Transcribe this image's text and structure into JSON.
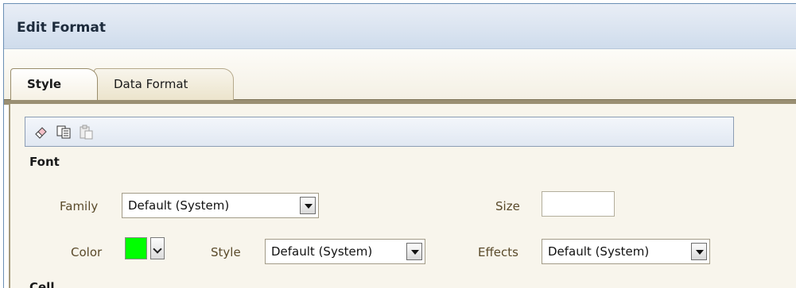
{
  "dialog": {
    "title": "Edit Format"
  },
  "tabs": [
    {
      "label": "Style",
      "active": true
    },
    {
      "label": "Data Format",
      "active": false
    }
  ],
  "toolbar": {
    "icons": [
      "eraser-icon",
      "copy-icon",
      "paste-icon"
    ]
  },
  "font_section": {
    "heading": "Font",
    "family_label": "Family",
    "family_value": "Default (System)",
    "size_label": "Size",
    "size_value": "",
    "color_label": "Color",
    "color_value": "#00ff00",
    "style_label": "Style",
    "style_value": "Default (System)",
    "effects_label": "Effects",
    "effects_value": "Default (System)"
  },
  "next_section": {
    "heading": "Cell"
  },
  "colors": {
    "title_bar": "#cfdcec",
    "panel_bg": "#f8f5ec",
    "tab_border": "#9a8d6b"
  }
}
